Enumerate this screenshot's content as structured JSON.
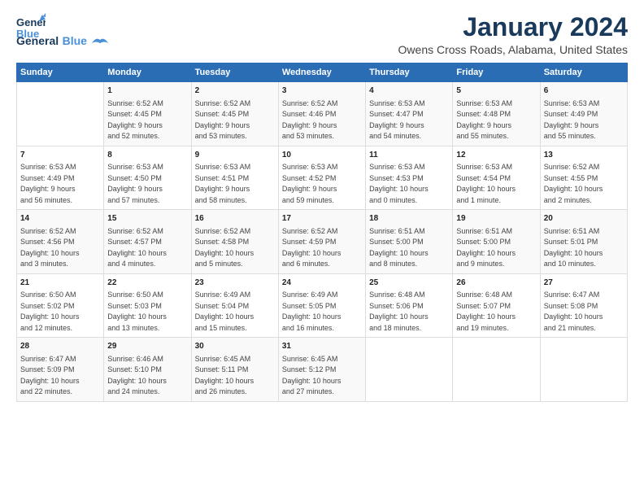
{
  "header": {
    "logo_line1": "General",
    "logo_line2": "Blue",
    "month_title": "January 2024",
    "location": "Owens Cross Roads, Alabama, United States"
  },
  "days_of_week": [
    "Sunday",
    "Monday",
    "Tuesday",
    "Wednesday",
    "Thursday",
    "Friday",
    "Saturday"
  ],
  "weeks": [
    [
      {
        "day": "",
        "content": ""
      },
      {
        "day": "1",
        "content": "Sunrise: 6:52 AM\nSunset: 4:45 PM\nDaylight: 9 hours\nand 52 minutes."
      },
      {
        "day": "2",
        "content": "Sunrise: 6:52 AM\nSunset: 4:45 PM\nDaylight: 9 hours\nand 53 minutes."
      },
      {
        "day": "3",
        "content": "Sunrise: 6:52 AM\nSunset: 4:46 PM\nDaylight: 9 hours\nand 53 minutes."
      },
      {
        "day": "4",
        "content": "Sunrise: 6:53 AM\nSunset: 4:47 PM\nDaylight: 9 hours\nand 54 minutes."
      },
      {
        "day": "5",
        "content": "Sunrise: 6:53 AM\nSunset: 4:48 PM\nDaylight: 9 hours\nand 55 minutes."
      },
      {
        "day": "6",
        "content": "Sunrise: 6:53 AM\nSunset: 4:49 PM\nDaylight: 9 hours\nand 55 minutes."
      }
    ],
    [
      {
        "day": "7",
        "content": "Sunrise: 6:53 AM\nSunset: 4:49 PM\nDaylight: 9 hours\nand 56 minutes."
      },
      {
        "day": "8",
        "content": "Sunrise: 6:53 AM\nSunset: 4:50 PM\nDaylight: 9 hours\nand 57 minutes."
      },
      {
        "day": "9",
        "content": "Sunrise: 6:53 AM\nSunset: 4:51 PM\nDaylight: 9 hours\nand 58 minutes."
      },
      {
        "day": "10",
        "content": "Sunrise: 6:53 AM\nSunset: 4:52 PM\nDaylight: 9 hours\nand 59 minutes."
      },
      {
        "day": "11",
        "content": "Sunrise: 6:53 AM\nSunset: 4:53 PM\nDaylight: 10 hours\nand 0 minutes."
      },
      {
        "day": "12",
        "content": "Sunrise: 6:53 AM\nSunset: 4:54 PM\nDaylight: 10 hours\nand 1 minute."
      },
      {
        "day": "13",
        "content": "Sunrise: 6:52 AM\nSunset: 4:55 PM\nDaylight: 10 hours\nand 2 minutes."
      }
    ],
    [
      {
        "day": "14",
        "content": "Sunrise: 6:52 AM\nSunset: 4:56 PM\nDaylight: 10 hours\nand 3 minutes."
      },
      {
        "day": "15",
        "content": "Sunrise: 6:52 AM\nSunset: 4:57 PM\nDaylight: 10 hours\nand 4 minutes."
      },
      {
        "day": "16",
        "content": "Sunrise: 6:52 AM\nSunset: 4:58 PM\nDaylight: 10 hours\nand 5 minutes."
      },
      {
        "day": "17",
        "content": "Sunrise: 6:52 AM\nSunset: 4:59 PM\nDaylight: 10 hours\nand 6 minutes."
      },
      {
        "day": "18",
        "content": "Sunrise: 6:51 AM\nSunset: 5:00 PM\nDaylight: 10 hours\nand 8 minutes."
      },
      {
        "day": "19",
        "content": "Sunrise: 6:51 AM\nSunset: 5:00 PM\nDaylight: 10 hours\nand 9 minutes."
      },
      {
        "day": "20",
        "content": "Sunrise: 6:51 AM\nSunset: 5:01 PM\nDaylight: 10 hours\nand 10 minutes."
      }
    ],
    [
      {
        "day": "21",
        "content": "Sunrise: 6:50 AM\nSunset: 5:02 PM\nDaylight: 10 hours\nand 12 minutes."
      },
      {
        "day": "22",
        "content": "Sunrise: 6:50 AM\nSunset: 5:03 PM\nDaylight: 10 hours\nand 13 minutes."
      },
      {
        "day": "23",
        "content": "Sunrise: 6:49 AM\nSunset: 5:04 PM\nDaylight: 10 hours\nand 15 minutes."
      },
      {
        "day": "24",
        "content": "Sunrise: 6:49 AM\nSunset: 5:05 PM\nDaylight: 10 hours\nand 16 minutes."
      },
      {
        "day": "25",
        "content": "Sunrise: 6:48 AM\nSunset: 5:06 PM\nDaylight: 10 hours\nand 18 minutes."
      },
      {
        "day": "26",
        "content": "Sunrise: 6:48 AM\nSunset: 5:07 PM\nDaylight: 10 hours\nand 19 minutes."
      },
      {
        "day": "27",
        "content": "Sunrise: 6:47 AM\nSunset: 5:08 PM\nDaylight: 10 hours\nand 21 minutes."
      }
    ],
    [
      {
        "day": "28",
        "content": "Sunrise: 6:47 AM\nSunset: 5:09 PM\nDaylight: 10 hours\nand 22 minutes."
      },
      {
        "day": "29",
        "content": "Sunrise: 6:46 AM\nSunset: 5:10 PM\nDaylight: 10 hours\nand 24 minutes."
      },
      {
        "day": "30",
        "content": "Sunrise: 6:45 AM\nSunset: 5:11 PM\nDaylight: 10 hours\nand 26 minutes."
      },
      {
        "day": "31",
        "content": "Sunrise: 6:45 AM\nSunset: 5:12 PM\nDaylight: 10 hours\nand 27 minutes."
      },
      {
        "day": "",
        "content": ""
      },
      {
        "day": "",
        "content": ""
      },
      {
        "day": "",
        "content": ""
      }
    ]
  ]
}
